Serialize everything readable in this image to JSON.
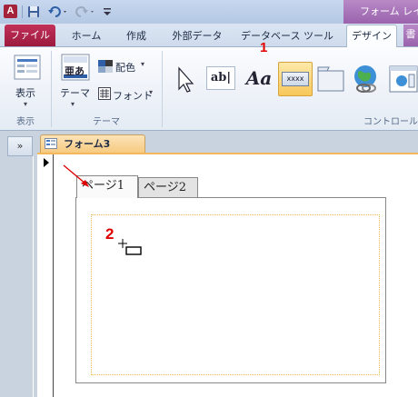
{
  "titlebar": {
    "app_icon_letter": "A",
    "contextual_title": "フォーム レイ"
  },
  "tabs": {
    "file": "ファイル",
    "home": "ホーム",
    "create": "作成",
    "external": "外部データ",
    "database_tools": "データベース ツール",
    "design": "デザイン",
    "more": "書"
  },
  "ribbon": {
    "view_label": "表示",
    "view_group": "表示",
    "theme_label": "テーマ",
    "colors_label": "配色",
    "fonts_label": "フォント",
    "theme_group": "テーマ",
    "controls_group": "コントロール",
    "label_control_text": "Aa",
    "textbox_control_text": "ab|",
    "button_control_text": "xxxx",
    "theme_icon_text": "亜あ"
  },
  "annotations": {
    "one": "1",
    "two": "2"
  },
  "document": {
    "tab_title": "フォーム3",
    "nav_toggle": "»",
    "page1": "ページ1",
    "page2": "ページ2"
  }
}
